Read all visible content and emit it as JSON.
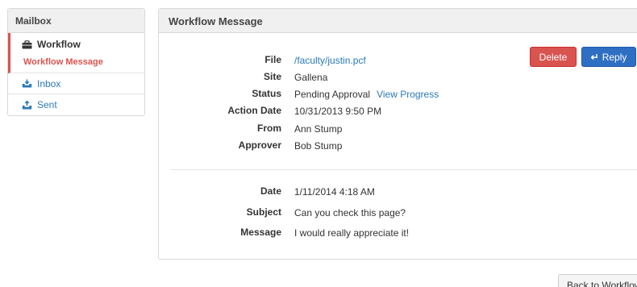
{
  "sidebar": {
    "title": "Mailbox",
    "items": [
      {
        "label": "Workflow",
        "icon": "briefcase-icon",
        "sub_label": "Workflow Message"
      },
      {
        "label": "Inbox",
        "icon": "inbox-icon"
      },
      {
        "label": "Sent",
        "icon": "sent-icon"
      }
    ]
  },
  "panel": {
    "title": "Workflow Message",
    "buttons": {
      "delete": "Delete",
      "reply": "Reply"
    },
    "fields": [
      {
        "label": "File",
        "value": "/faculty/justin.pcf"
      },
      {
        "label": "Site",
        "value": "Gallena"
      },
      {
        "label": "Status",
        "value": "Pending Approval",
        "link": "View Progress"
      },
      {
        "label": "Action Date",
        "value": "10/31/2013 9:50 PM"
      },
      {
        "label": "From",
        "value": "Ann Stump"
      },
      {
        "label": "Approver",
        "value": "Bob Stump"
      }
    ],
    "message_fields": [
      {
        "label": "Date",
        "value": "1/11/2014 4:18 AM"
      },
      {
        "label": "Subject",
        "value": "Can you check this page?"
      },
      {
        "label": "Message",
        "value": "I would really appreciate it!"
      }
    ]
  },
  "footer": {
    "back_button": "Back to Workflow"
  },
  "colors": {
    "accent_red": "#d9534f",
    "primary_blue": "#2e6fc4",
    "link_blue": "#2a7ab8"
  }
}
